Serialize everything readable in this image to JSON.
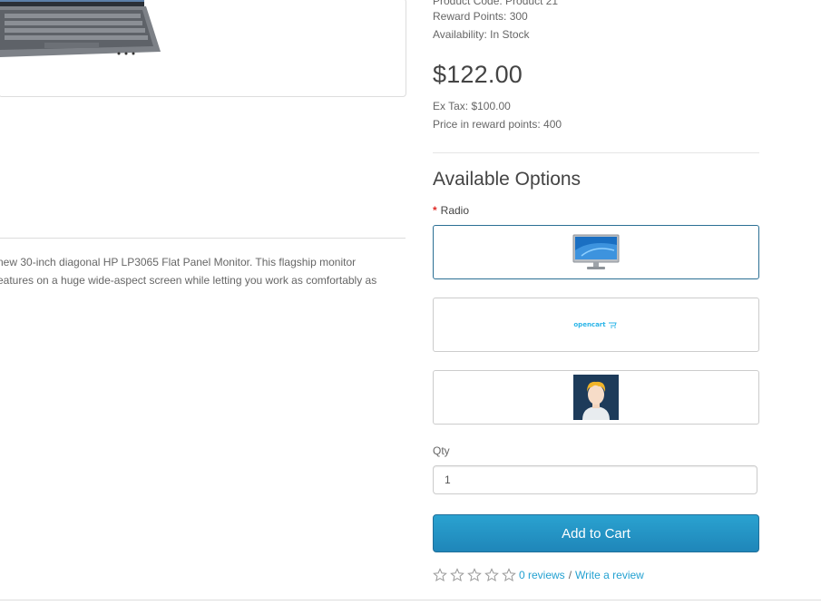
{
  "product": {
    "product_code": "Product Code: Product 21",
    "reward_points": "Reward Points: 300",
    "availability": "Availability: In Stock",
    "price": "$122.00",
    "ex_tax": "Ex Tax: $100.00",
    "price_in_points": "Price in reward points: 400"
  },
  "description": {
    "line1": "new 30-inch diagonal HP LP3065 Flat Panel Monitor. This flagship monitor",
    "line2": "eatures on a huge wide-aspect screen while letting you work as comfortably as"
  },
  "options": {
    "title": "Available Options",
    "radio_label": "Radio",
    "required_mark": "*",
    "choices": [
      {
        "icon": "monitor-image-icon",
        "selected": true
      },
      {
        "icon": "opencart-logo-icon",
        "text": "opencart",
        "selected": false
      },
      {
        "icon": "user-avatar-icon",
        "selected": false
      }
    ]
  },
  "qty": {
    "label": "Qty",
    "value": "1"
  },
  "cart": {
    "button_label": "Add to Cart"
  },
  "reviews": {
    "stars": 0,
    "count_link": "0 reviews",
    "separator": "/",
    "write_link": "Write a review"
  },
  "colors": {
    "accent": "#23a1d1",
    "button": "#229ac8",
    "selected_border": "#2b6f94"
  }
}
